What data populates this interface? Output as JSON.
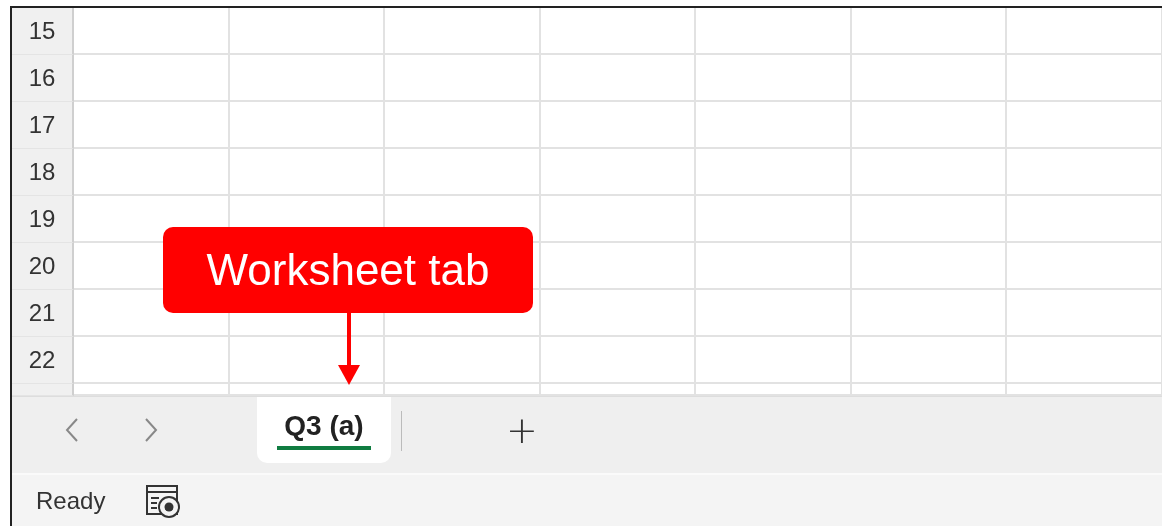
{
  "grid": {
    "row_numbers": [
      "15",
      "16",
      "17",
      "18",
      "19",
      "20",
      "21",
      "22"
    ]
  },
  "callout": {
    "text": "Worksheet tab"
  },
  "sheet_tabs": [
    {
      "label": "Q3 (a)",
      "selected": true
    }
  ],
  "add_sheet": {
    "label": "+"
  },
  "status_bar": {
    "status": "Ready"
  }
}
